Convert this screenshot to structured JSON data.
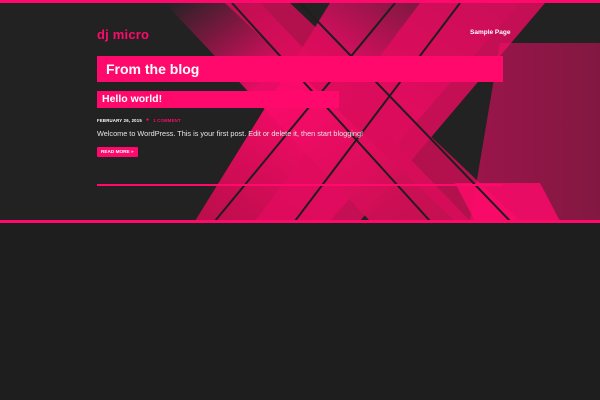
{
  "colors": {
    "accent": "#ff0a6c",
    "dark_stripe": "#c0104e",
    "background": "#1e1e1e",
    "hero_background": "#222222"
  },
  "header": {
    "site_title": "dj micro",
    "nav": [
      {
        "label": "Sample Page"
      }
    ]
  },
  "main": {
    "page_heading": "From the blog",
    "posts": [
      {
        "title": "Hello world!",
        "date": "FEBRUARY 26, 2015",
        "separator": "●",
        "comments": "1 COMMENT",
        "excerpt": "Welcome to WordPress. This is your first post. Edit or delete it, then start blogging!",
        "read_more": "READ MORE »"
      }
    ]
  }
}
